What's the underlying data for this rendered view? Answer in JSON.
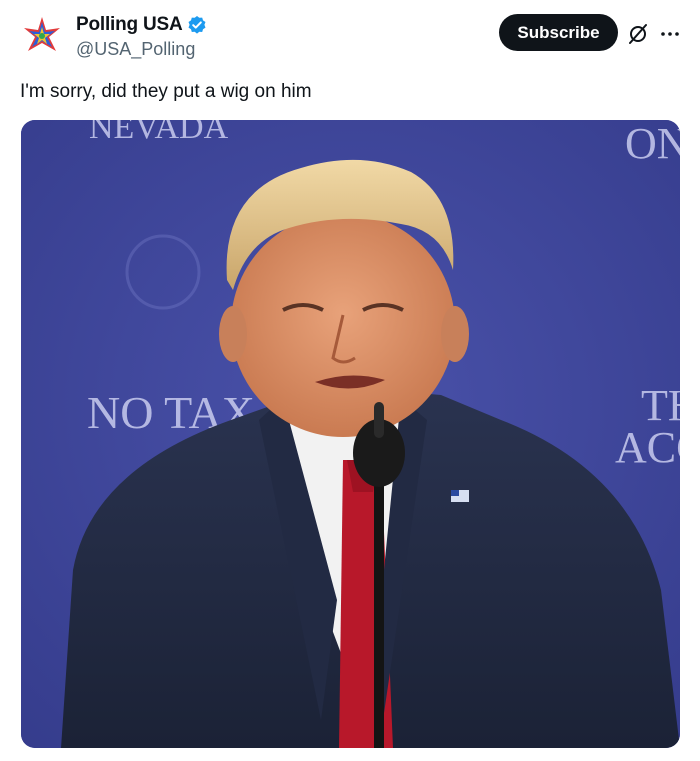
{
  "author": {
    "display_name": "Polling USA",
    "handle": "@USA_Polling",
    "verified_icon": "verified-badge-icon",
    "avatar_icon": "star-logo-icon"
  },
  "actions": {
    "subscribe_label": "Subscribe",
    "grok_icon": "grok-icon",
    "more_icon": "more-options-icon"
  },
  "tweet": {
    "text": "I'm sorry, did they put a wig on him"
  },
  "media": {
    "background_texts": {
      "top_left": "NEVADA",
      "top_right": "ON",
      "mid_left": "NO TAX",
      "right_line1": "TH",
      "right_line2": "ACC"
    }
  },
  "colors": {
    "accent_verified": "#1d9bf0",
    "button_bg": "#0f1419",
    "backdrop_blue": "#3d4499",
    "secondary_text": "#536471"
  }
}
